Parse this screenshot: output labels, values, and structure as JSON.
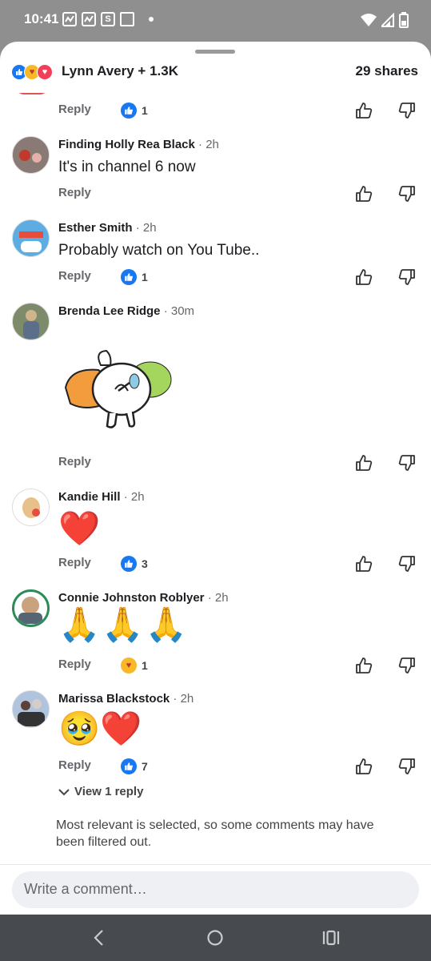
{
  "status_bar": {
    "time": "10:41",
    "s_icon": "S",
    "notification_icons": [
      "notification-icon",
      "notification-icon",
      "s-app-icon",
      "screenshot-icon",
      "more-dot-icon"
    ],
    "system_icons": [
      "wifi-icon",
      "signal-icon",
      "battery-icon"
    ]
  },
  "header": {
    "reaction_icons": [
      "like-icon",
      "care-icon",
      "love-icon"
    ],
    "people": "Lynn Avery + 1.3K",
    "shares": "29 shares"
  },
  "comments": [
    {
      "name": "",
      "time": "",
      "text": "",
      "reply": "Reply",
      "reaction_count": "1",
      "reaction_icon": "like-icon"
    },
    {
      "name": "Finding Holly Rea Black",
      "time": "2h",
      "text": "It's in channel 6 now",
      "reply": "Reply"
    },
    {
      "name": "Esther Smith",
      "time": "2h",
      "text": "Probably watch on You Tube..",
      "reply": "Reply",
      "reaction_count": "1",
      "reaction_icon": "like-icon"
    },
    {
      "name": "Brenda Lee Ridge",
      "time": "30m",
      "text": "",
      "sticker": "bunny-carrot-sticker",
      "reply": "Reply"
    },
    {
      "name": "Kandie Hill",
      "time": "2h",
      "text": "❤️",
      "reply": "Reply",
      "reaction_count": "3",
      "reaction_icon": "like-icon"
    },
    {
      "name": "Connie Johnston Roblyer",
      "time": "2h",
      "text": "🙏🙏🙏",
      "reply": "Reply",
      "reaction_count": "1",
      "reaction_icon": "care-icon"
    },
    {
      "name": "Marissa Blackstock",
      "time": "2h",
      "text": "🥹❤️",
      "reply": "Reply",
      "reaction_count": "7",
      "reaction_icon": "like-icon"
    }
  ],
  "view_reply": "View 1 reply",
  "notice": "Most relevant is selected, so some comments may have been filtered out.",
  "composer": {
    "placeholder": "Write a comment…"
  },
  "nav": [
    "back-icon",
    "home-icon",
    "recents-icon"
  ],
  "colors": {
    "accent": "#1877f2",
    "love": "#f33e58",
    "care": "#f7b928"
  }
}
